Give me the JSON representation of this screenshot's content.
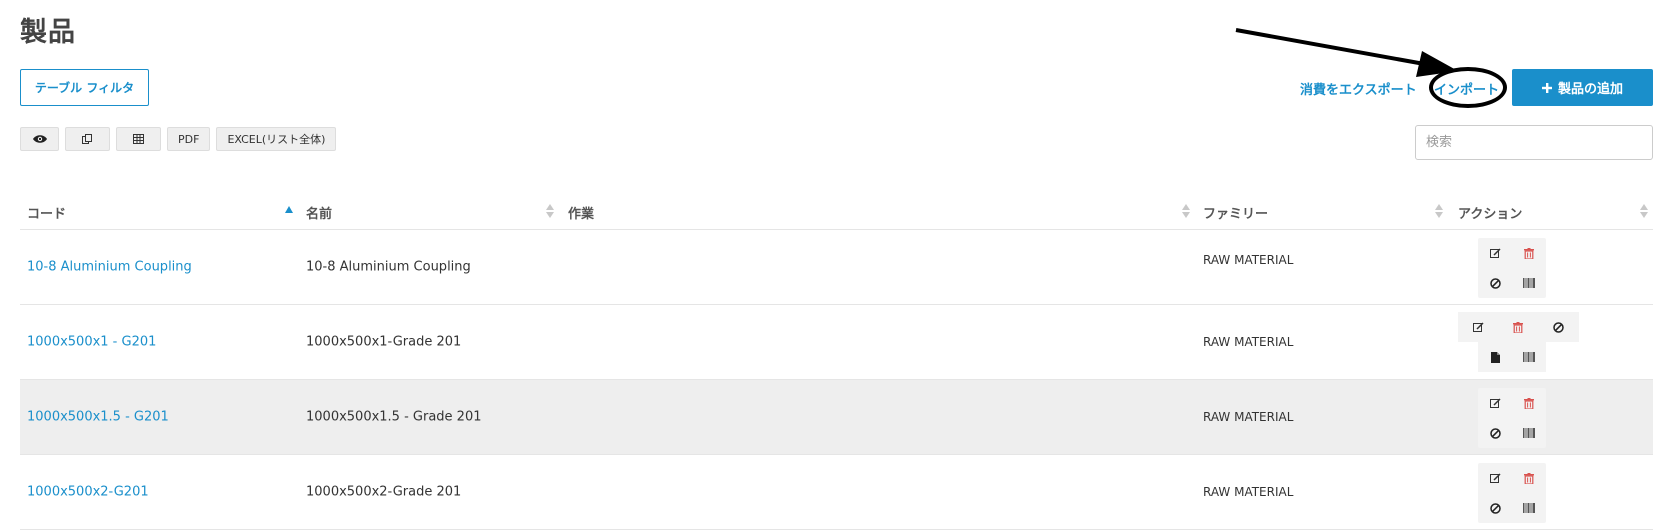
{
  "page": {
    "title": "製品"
  },
  "toolbar": {
    "filter_label": "テーブル フィルタ",
    "export_label": "消費をエクスポート",
    "import_label": "インポート",
    "add_label": "製品の追加",
    "pdf_label": "PDF",
    "excel_label": "EXCEL(リスト全体)"
  },
  "search": {
    "placeholder": "検索",
    "value": ""
  },
  "table": {
    "columns": {
      "code": "コード",
      "name": "名前",
      "work": "作業",
      "family": "ファミリー",
      "actions": "アクション"
    },
    "sorted_column": "code",
    "rows": [
      {
        "code": "10-8 Aluminium Coupling",
        "name": "10-8 Aluminium Coupling",
        "work": "",
        "family": "RAW MATERIAL",
        "actions": [
          "edit",
          "delete",
          "disable",
          "barcode"
        ]
      },
      {
        "code": "1000x500x1 - G201",
        "name": "1000x500x1-Grade 201",
        "work": "",
        "family": "RAW MATERIAL",
        "actions": [
          "edit",
          "delete",
          "disable",
          "file",
          "barcode"
        ]
      },
      {
        "code": "1000x500x1.5 - G201",
        "name": "1000x500x1.5 - Grade 201",
        "work": "",
        "family": "RAW MATERIAL",
        "actions": [
          "edit",
          "delete",
          "disable",
          "barcode"
        ]
      },
      {
        "code": "1000x500x2-G201",
        "name": "1000x500x2-Grade 201",
        "work": "",
        "family": "RAW MATERIAL",
        "actions": [
          "edit",
          "delete",
          "disable",
          "barcode"
        ]
      }
    ]
  },
  "colors": {
    "accent": "#1a8fcb",
    "delete": "#d9534f",
    "highlight_row": "#eeeeee"
  },
  "icons": [
    "eye-icon",
    "copy-icon",
    "table-icon",
    "plus-icon",
    "edit-icon",
    "trash-icon",
    "ban-icon",
    "barcode-icon",
    "file-icon",
    "sort-icon"
  ]
}
